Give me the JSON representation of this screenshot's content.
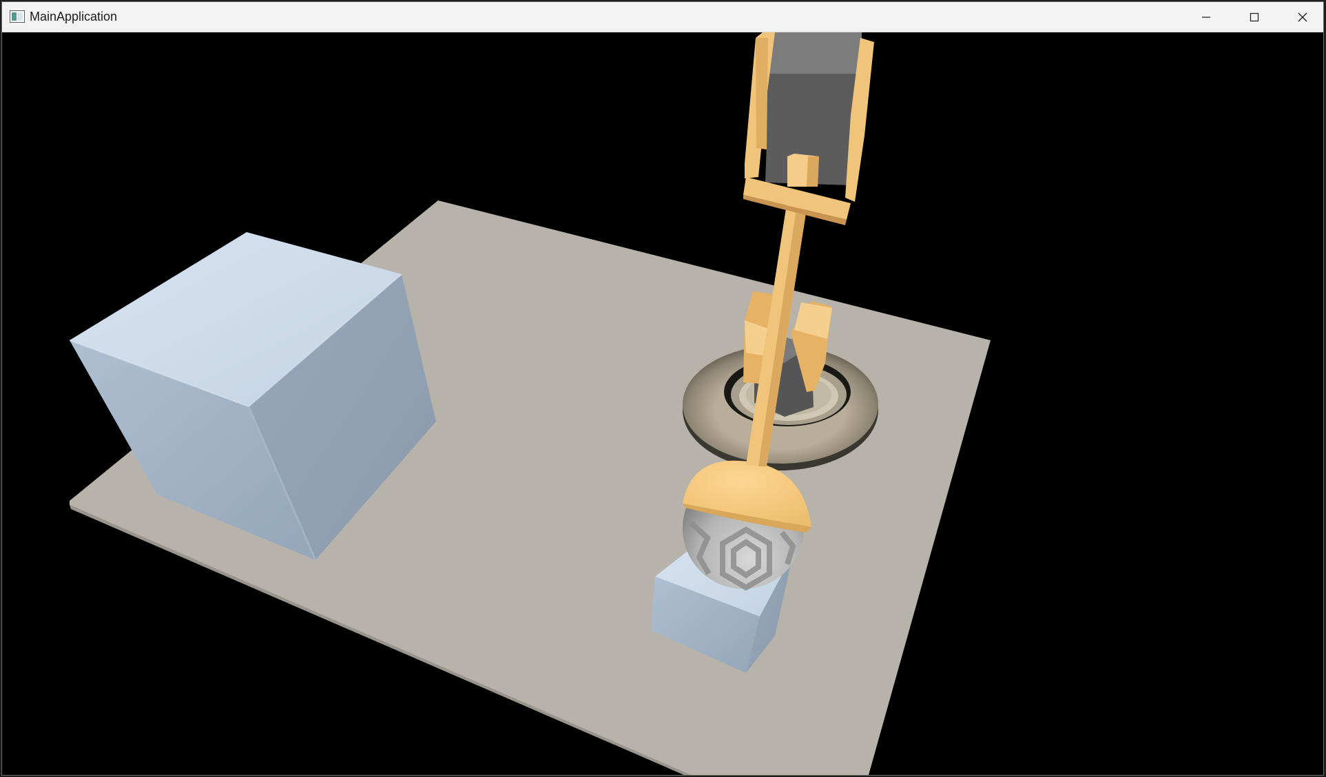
{
  "window": {
    "title": "MainApplication",
    "controls": {
      "minimize_icon": "minimize-icon",
      "maximize_icon": "maximize-icon",
      "close_icon": "close-icon"
    }
  },
  "colors": {
    "titlebar": "#f3f3f3",
    "viewport_background": "#000000",
    "floor": "#b8b3aa",
    "cube": "#9aabbd",
    "cube_top": "#cfdcec",
    "robot_arm": "#f0c47a",
    "motor": "#5f5f5f",
    "ring": "#8a8172",
    "ball": "#bcbcbc"
  }
}
